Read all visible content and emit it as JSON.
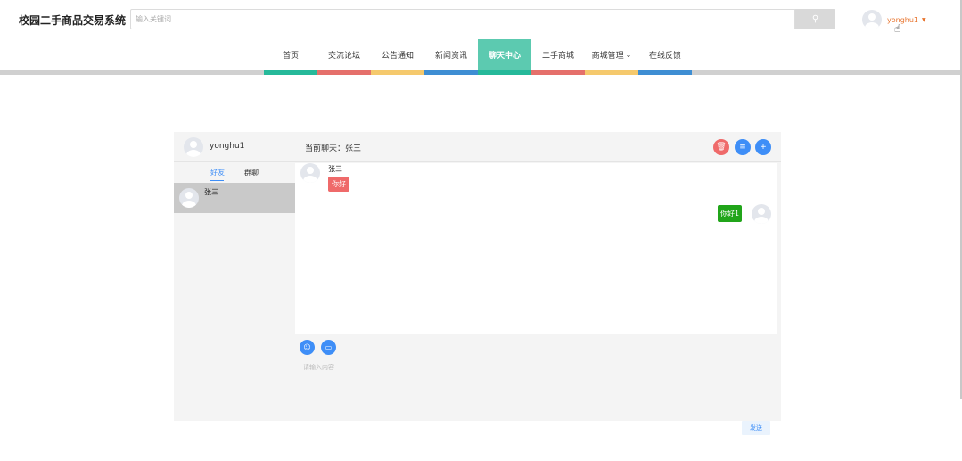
{
  "header": {
    "brand": "校园二手商品交易系统",
    "search_placeholder": "输入关键词",
    "username": "yonghu1"
  },
  "nav": {
    "items": [
      {
        "label": "首页",
        "color": "#26b99a"
      },
      {
        "label": "交流论坛",
        "color": "#e5706b"
      },
      {
        "label": "公告通知",
        "color": "#f5c96d"
      },
      {
        "label": "新闻资讯",
        "color": "#3e8ed3"
      },
      {
        "label": "聊天中心",
        "color": "#26b99a",
        "active": true
      },
      {
        "label": "二手商城",
        "color": "#e5706b"
      },
      {
        "label": "商城管理",
        "color": "#f5c96d",
        "has_dropdown": true
      },
      {
        "label": "在线反馈",
        "color": "#3e8ed3"
      }
    ]
  },
  "chat": {
    "me": "yonghu1",
    "current": "当前聊天：张三",
    "tabs": [
      "好友",
      "群聊"
    ],
    "contacts": [
      {
        "name": "张三"
      }
    ],
    "messages": [
      {
        "side": "left",
        "name": "张三",
        "text": "你好",
        "color": "#ef6a6a"
      },
      {
        "side": "right",
        "text": "你好1",
        "color": "#21a51a"
      }
    ],
    "input_placeholder": "请输入内容",
    "send_label": "发送",
    "action_colors": {
      "delete": "#ef6a6a",
      "menu": "#3e8ef7",
      "add": "#3e8ef7"
    }
  }
}
